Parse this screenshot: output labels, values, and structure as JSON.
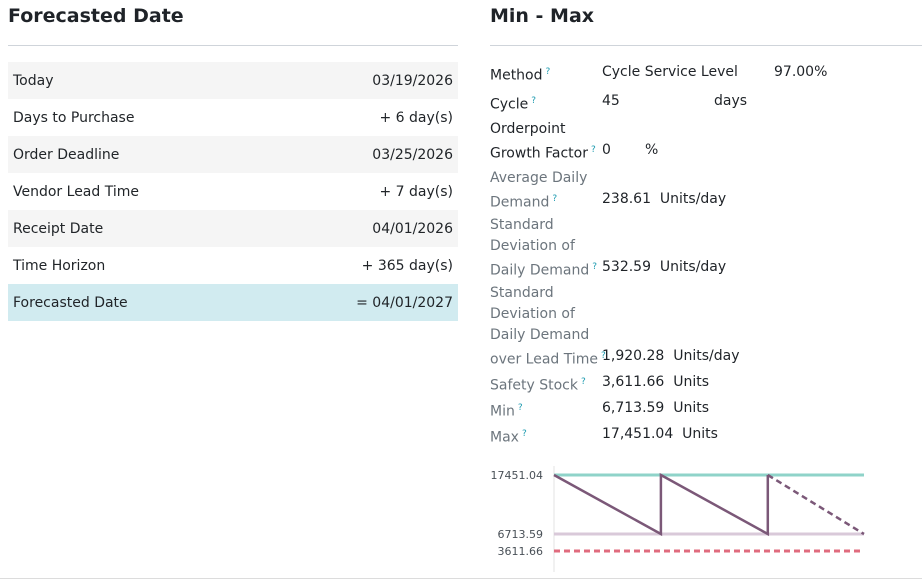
{
  "forecast": {
    "title": "Forecasted Date",
    "rows": [
      {
        "label": "Today",
        "value": "03/19/2026"
      },
      {
        "label": "Days to Purchase",
        "value": "+ 6 day(s)"
      },
      {
        "label": "Order Deadline",
        "value": "03/25/2026"
      },
      {
        "label": "Vendor Lead Time",
        "value": "+ 7 day(s)"
      },
      {
        "label": "Receipt Date",
        "value": "04/01/2026"
      },
      {
        "label": "Time Horizon",
        "value": "+ 365 day(s)"
      },
      {
        "label": "Forecasted Date",
        "value": "= 04/01/2027"
      }
    ]
  },
  "minmax": {
    "title": "Min - Max",
    "method_label": "Method",
    "method_value": "Cycle Service Level",
    "method_percent": "97.00%",
    "cycle_label": "Cycle",
    "cycle_value": "45",
    "cycle_unit": "days",
    "growth_label_1": "Orderpoint",
    "growth_label_2": "Growth Factor",
    "growth_value": "0",
    "growth_unit": "%",
    "avg_label_1": "Average Daily",
    "avg_label_2": "Demand",
    "avg_value": "238.61",
    "avg_unit": "Units/day",
    "std_label_1": "Standard",
    "std_label_2": "Deviation of",
    "std_label_3": "Daily Demand",
    "std_value": "532.59",
    "std_unit": "Units/day",
    "stdlt_label_1": "Standard",
    "stdlt_label_2": "Deviation of",
    "stdlt_label_3": "Daily Demand",
    "stdlt_label_4": "over Lead Time",
    "stdlt_value": "1,920.28",
    "stdlt_unit": "Units/day",
    "safety_label": "Safety Stock",
    "safety_value": "3,611.66",
    "safety_unit": "Units",
    "min_label": "Min",
    "min_value": "6,713.59",
    "min_unit": "Units",
    "max_label": "Max",
    "max_value": "17,451.04",
    "max_unit": "Units",
    "help_mark": "?"
  },
  "chart_data": {
    "type": "line",
    "ylim": [
      0,
      17451.04
    ],
    "yticks": [
      "17451.04",
      "6713.59",
      "3611.66"
    ],
    "reference_lines": [
      {
        "value": 17451.04,
        "color": "#8fd3c9",
        "style": "solid"
      },
      {
        "value": 6713.59,
        "color": "#d9c9d9",
        "style": "solid"
      },
      {
        "value": 3611.66,
        "color": "#e06b7e",
        "style": "dashed"
      }
    ],
    "stock_line_color": "#7b5878",
    "x": [
      0,
      1,
      1,
      2,
      2,
      2.9
    ],
    "y": [
      17451.04,
      6713.59,
      17451.04,
      6713.59,
      17451.04,
      6713.59
    ],
    "projected_from_index": 4
  }
}
